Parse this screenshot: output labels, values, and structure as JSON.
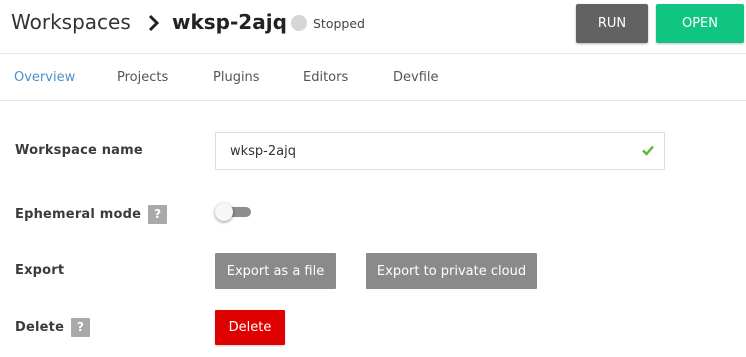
{
  "header": {
    "breadcrumb_root": "Workspaces",
    "breadcrumb_separator_icon": "chevron-right-icon",
    "workspace_title": "wksp-2ajq",
    "status": {
      "text": "Stopped",
      "dot_color": "#d5d5d5"
    },
    "run_label": "RUN",
    "open_label": "OPEN"
  },
  "tabs": [
    {
      "label": "Overview",
      "active": true
    },
    {
      "label": "Projects",
      "active": false
    },
    {
      "label": "Plugins",
      "active": false
    },
    {
      "label": "Editors",
      "active": false
    },
    {
      "label": "Devfile",
      "active": false
    }
  ],
  "form": {
    "workspace_name": {
      "label": "Workspace name",
      "value": "wksp-2ajq",
      "valid_icon": "checkmark-icon"
    },
    "ephemeral_mode": {
      "label": "Ephemeral mode",
      "help": "?",
      "enabled": false
    },
    "export": {
      "label": "Export",
      "file_button": "Export as a file",
      "cloud_button": "Export to private cloud"
    },
    "delete": {
      "label": "Delete",
      "help": "?",
      "button": "Delete"
    }
  },
  "colors": {
    "accent_tab": "#4a90c9",
    "run_button": "#626262",
    "open_button": "#10c581",
    "delete_button": "#df0000",
    "secondary_button": "#8a8a8a",
    "valid_check": "#5db531"
  }
}
